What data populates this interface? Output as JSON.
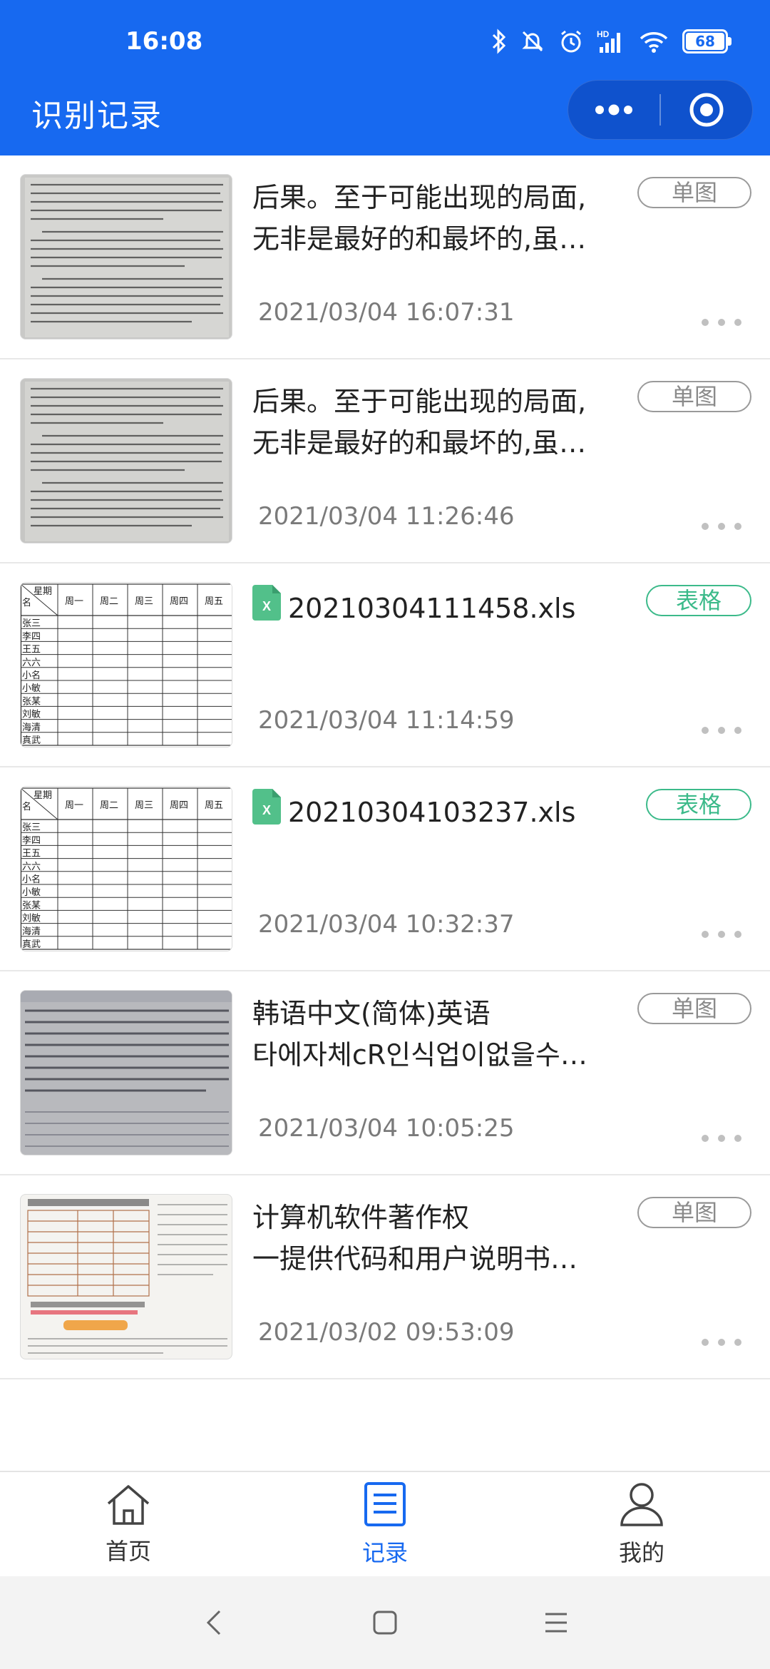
{
  "status_bar": {
    "time": "16:08",
    "network": "HD",
    "battery": "68",
    "icons": [
      "bluetooth-icon",
      "mute-icon",
      "alarm-icon",
      "signal-icon",
      "wifi-icon",
      "battery-icon"
    ]
  },
  "header": {
    "title": "识别记录",
    "more_icon": "more-horizontal-icon",
    "close_icon": "target-icon",
    "background": "#1769f0"
  },
  "records": [
    {
      "line1": "后果。至于可能出现的局面,",
      "line2": "无非是最好的和最坏的,虽…",
      "time": "2021/03/04 16:07:31",
      "tag": "单图",
      "kind": "text-scan"
    },
    {
      "line1": "后果。至于可能出现的局面,",
      "line2": "无非是最好的和最坏的,虽…",
      "time": "2021/03/04 11:26:46",
      "tag": "单图",
      "kind": "text-scan"
    },
    {
      "line1": "20210304111458.xls",
      "line2": "",
      "time": "2021/03/04 11:14:59",
      "tag": "表格",
      "kind": "table"
    },
    {
      "line1": "20210304103237.xls",
      "line2": "",
      "time": "2021/03/04 10:32:37",
      "tag": "表格",
      "kind": "table"
    },
    {
      "line1": "韩语中文(简体)英语",
      "line2": "타에자체cR인식업이없을수…",
      "time": "2021/03/04 10:05:25",
      "tag": "单图",
      "kind": "korean-scan"
    },
    {
      "line1": "计算机软件著作权",
      "line2": "一提供代码和用户说明书…",
      "time": "2021/03/02 09:53:09",
      "tag": "单图",
      "kind": "price-sheet"
    }
  ],
  "table_thumb": {
    "header_corner_top": "星期",
    "header_corner_bottom": "名",
    "days": [
      "周一",
      "周二",
      "周三",
      "周四",
      "周五"
    ],
    "names": [
      "张三",
      "李四",
      "王五",
      "六六",
      "小名",
      "小敏",
      "张某",
      "刘敏",
      "海清",
      "真武"
    ]
  },
  "tabbar": {
    "items": [
      {
        "label": "首页",
        "icon": "home-icon",
        "active": false
      },
      {
        "label": "记录",
        "icon": "document-list-icon",
        "active": true
      },
      {
        "label": "我的",
        "icon": "user-icon",
        "active": false
      }
    ],
    "active_color": "#1769f0"
  },
  "system_nav": [
    "back-icon",
    "home-square-icon",
    "menu-icon"
  ],
  "colors": {
    "tag_single": "#9a9a9a",
    "tag_table": "#3cba8a"
  }
}
